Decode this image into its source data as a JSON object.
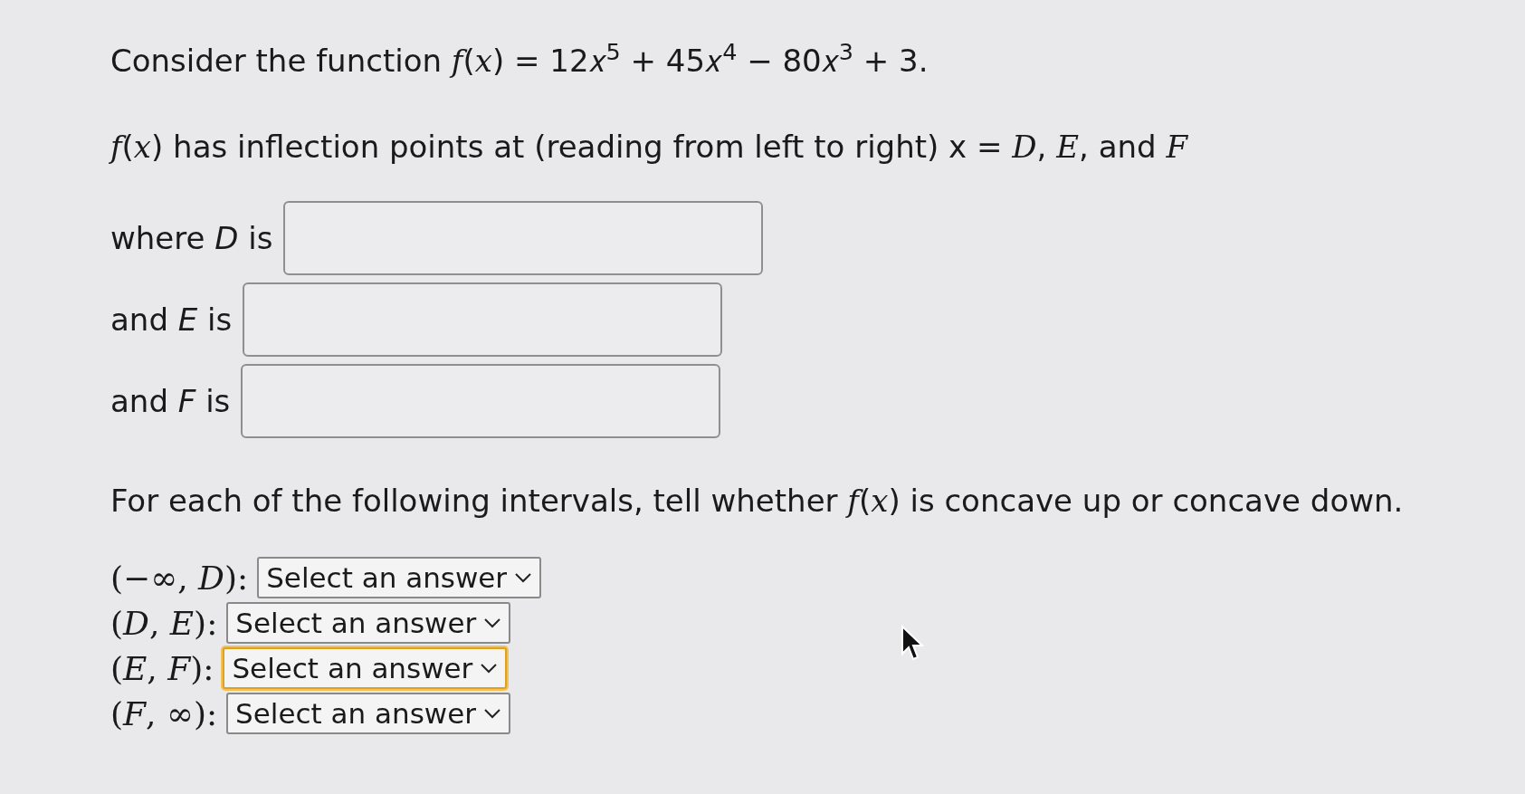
{
  "intro": "Consider the function *f*(*x*) = 12𝑥$^{5}$ + 45𝑥$^{4}$ − 80𝑥$^{3}$ + 3.",
  "statement": "*f*(*x*) has inflection points at (reading from left to right) x = *D*, *E*, and *F*",
  "fields": [
    {
      "label": "where *D* is"
    },
    {
      "label": "and *E* is"
    },
    {
      "label": "and *F* is"
    }
  ],
  "prompt": "For each of the following intervals, tell whether *f*(*x*) is concave up or concave down.",
  "selects": [
    {
      "interval": "(−∞, *D*):",
      "value": "Select an answer",
      "focused": false
    },
    {
      "interval": "(*D*, *E*):",
      "value": "Select an answer",
      "focused": false
    },
    {
      "interval": "(*E*, *F*):",
      "value": "Select an answer",
      "focused": true
    },
    {
      "interval": "(*F*, ∞):",
      "value": "Select an answer",
      "focused": false
    }
  ]
}
